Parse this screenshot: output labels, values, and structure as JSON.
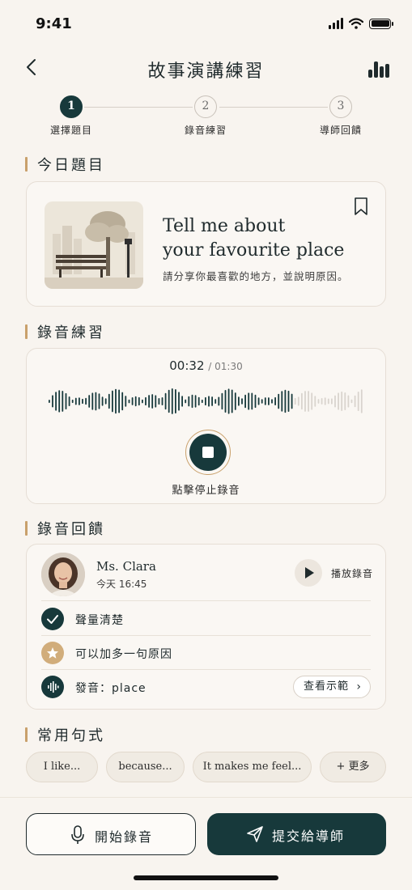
{
  "status_bar": {
    "time": "9:41"
  },
  "header": {
    "title": "故事演講練習"
  },
  "stepper": {
    "steps": [
      {
        "number": "1",
        "label": "選擇題目"
      },
      {
        "number": "2",
        "label": "錄音練習"
      },
      {
        "number": "3",
        "label": "導師回饋"
      }
    ],
    "active_step": 1
  },
  "sections": {
    "topic": "今日題目",
    "recording": "錄音練習",
    "feedback": "錄音回饋",
    "phrases": "常用句式"
  },
  "topic": {
    "title_line1": "Tell me about",
    "title_line2": "your favourite place",
    "subtitle": "請分享你最喜歡的地方，並說明原因。"
  },
  "recording": {
    "elapsed": "00:32",
    "total": "/ 01:30",
    "progress": 0.36,
    "stop_label": "點擊停止錄音"
  },
  "feedback": {
    "teacher_name": "Ms. Clara",
    "teacher_time": "今天 16:45",
    "play_label": "播放錄音",
    "items": [
      {
        "icon": "check-icon",
        "text": "聲量清楚"
      },
      {
        "icon": "star-icon",
        "text": "可以加多一句原因"
      },
      {
        "icon": "waveform-icon",
        "text": "發音：place",
        "action": "查看示範"
      }
    ]
  },
  "phrases": [
    "I like...",
    "because...",
    "It makes me feel...",
    "+ 更多"
  ],
  "bottom": {
    "record_label": "開始錄音",
    "submit_label": "提交給導師"
  },
  "colors": {
    "primary": "#17393b",
    "accent_gold": "#c9a06b",
    "background": "#f8f4ef"
  }
}
